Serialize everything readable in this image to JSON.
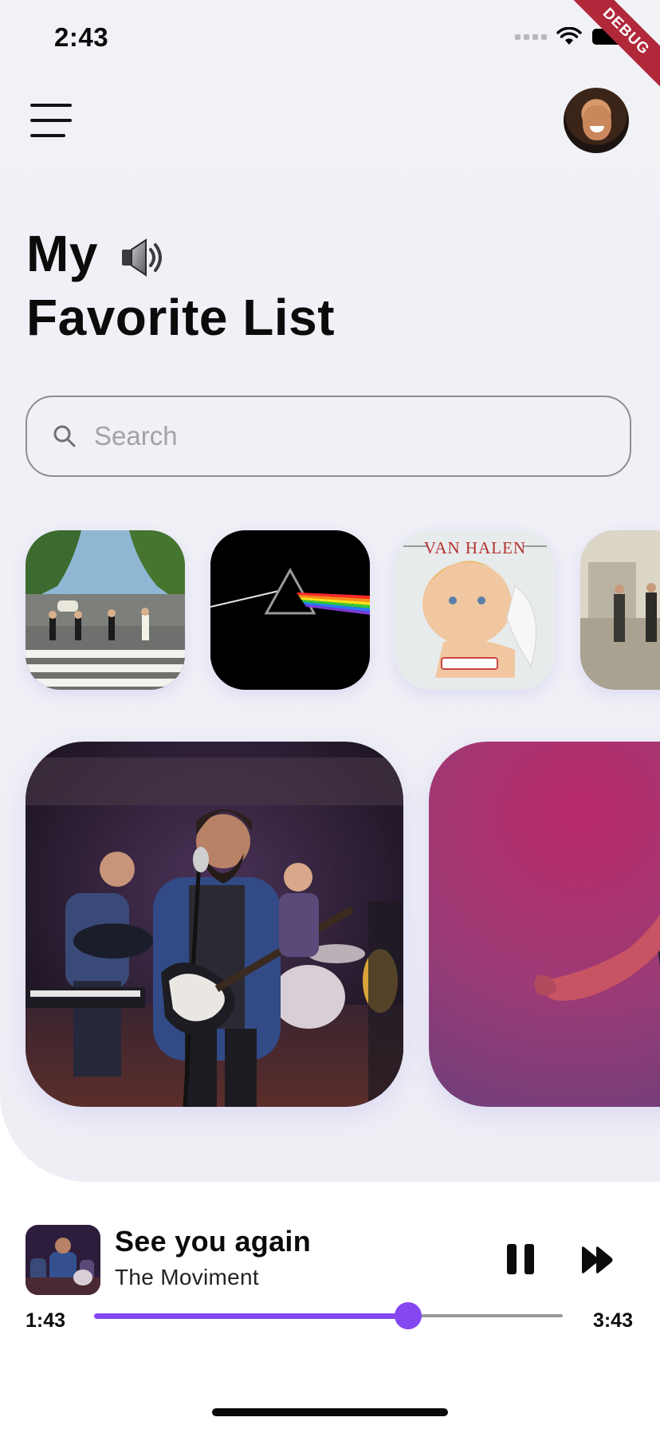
{
  "status_bar": {
    "time": "2:43"
  },
  "debug_banner": "DEBUG",
  "header": {
    "menu_icon": "hamburger-menu-icon",
    "avatar": "user-avatar"
  },
  "title": {
    "line1": "My",
    "speaker_icon": "speaker-icon",
    "line2": "Favorite List"
  },
  "search": {
    "placeholder": "Search",
    "value": ""
  },
  "albums": [
    {
      "name": "album-abbey-road",
      "text": ""
    },
    {
      "name": "album-dark-side",
      "text": ""
    },
    {
      "name": "album-van-halen",
      "text": "VAN HALEN"
    },
    {
      "name": "album-wish-you-were-here",
      "text": ""
    }
  ],
  "cards": [
    {
      "name": "band-live-card"
    },
    {
      "name": "performer-pink-card"
    }
  ],
  "player": {
    "song_title": "See you again",
    "artist": "The Moviment",
    "current_time": "1:43",
    "total_time": "3:43",
    "progress": 0.67,
    "accent_color": "#8547f0",
    "pause_icon": "pause-icon",
    "next_icon": "fast-forward-icon"
  }
}
